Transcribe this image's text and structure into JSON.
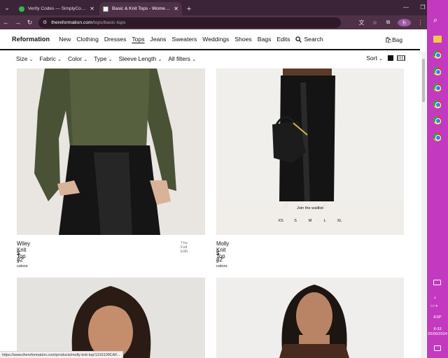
{
  "browser": {
    "tabs": [
      {
        "title": "Verify Codes — SimplyCodes",
        "active": false,
        "favicon": "simplycodes-favicon"
      },
      {
        "title": "Basic & Knit Tops - Women's Sw",
        "active": true,
        "favicon": "page-favicon"
      }
    ],
    "new_tab_label": "+",
    "url_host": "thereformation.com",
    "url_path": "/tops/basic-tops",
    "profile_initial": "h"
  },
  "site": {
    "logo": "Reformation",
    "nav": [
      "New",
      "Clothing",
      "Dresses",
      "Tops",
      "Jeans",
      "Sweaters",
      "Weddings",
      "Shoes",
      "Bags",
      "Edits"
    ],
    "active_nav": "Tops",
    "search_label": "Search",
    "bag_label": "Bag"
  },
  "filters": [
    "Size",
    "Fabric",
    "Color",
    "Type",
    "Sleeve Length",
    "All filters"
  ],
  "sort_label": "Sort",
  "products": [
    {
      "name": "Wiley Knit Top",
      "price": "$ 82",
      "colors": "3 colors",
      "badge": "The Fall Edit"
    },
    {
      "name": "Molly Knit Top",
      "price": "$ 82",
      "colors": "5 colors",
      "badge": "",
      "waitlist": "Join the waitlist",
      "sizes": [
        "XS",
        "S",
        "M",
        "L",
        "XL"
      ]
    }
  ],
  "status_url": "https://www.thereformation.com/products/molly-knit-top/1316109CAF...",
  "taskbar": {
    "language": "ESP",
    "time": "8:33",
    "date": "20/09/2024"
  },
  "colors": {
    "tab_strip": "#3b2437",
    "address_bar": "#4e3147",
    "side_panel": "#c33ac1"
  }
}
